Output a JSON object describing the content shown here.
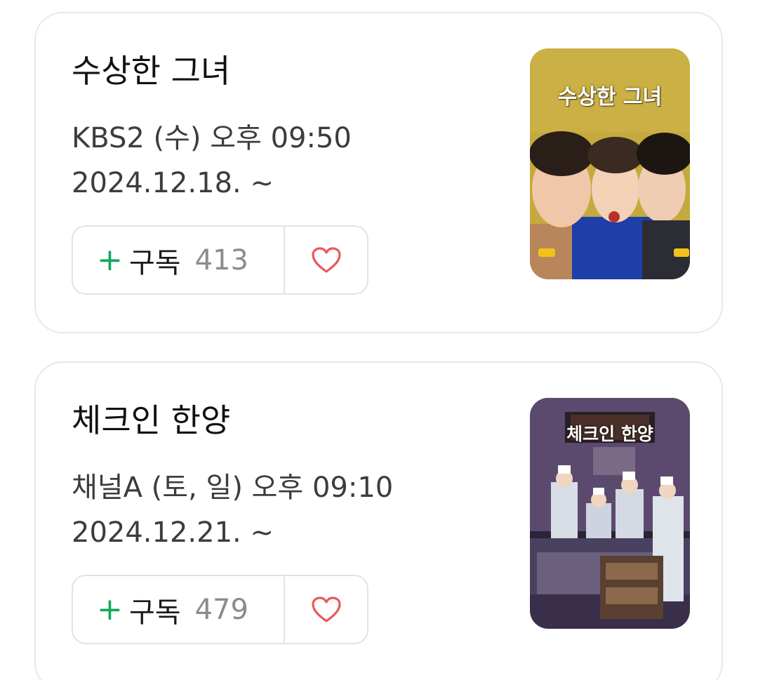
{
  "shows": [
    {
      "title": "수상한 그녀",
      "schedule": "KBS2 (수) 오후 09:50",
      "start_date": "2024.12.18. ~",
      "subscribe_label": "구독",
      "subscribe_count": "413",
      "poster_title": "수상한 그녀",
      "plus_icon": "+",
      "icon_names": [
        "plus-icon",
        "heart-icon"
      ]
    },
    {
      "title": "체크인 한양",
      "schedule": "채널A (토, 일) 오후 09:10",
      "start_date": "2024.12.21. ~",
      "subscribe_label": "구독",
      "subscribe_count": "479",
      "poster_title": "체크인 한양",
      "plus_icon": "+",
      "icon_names": [
        "plus-icon",
        "heart-icon"
      ]
    }
  ],
  "colors": {
    "plus": "#0ea85a",
    "heart": "#e8585a",
    "border": "#e8e8ea",
    "count": "#8c8c8c"
  }
}
